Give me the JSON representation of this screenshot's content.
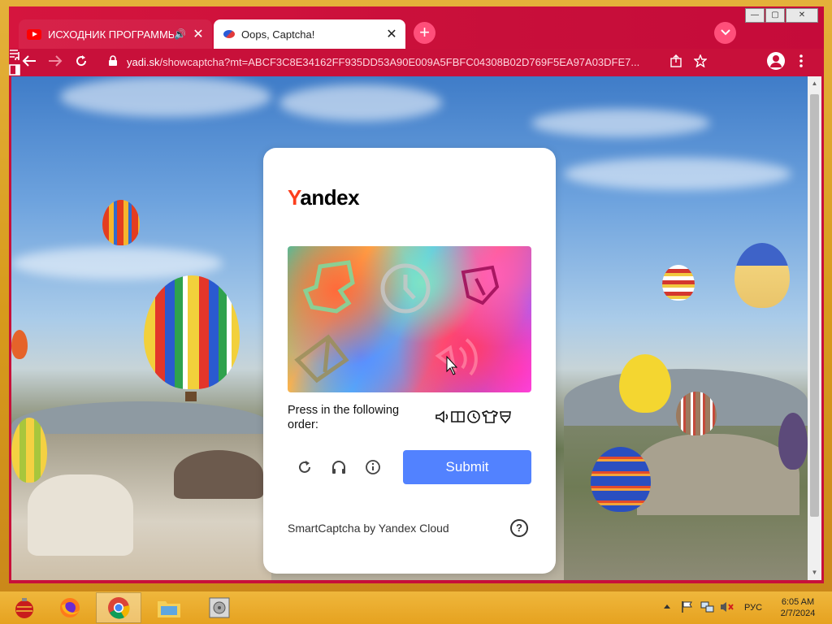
{
  "browser": {
    "tabs": [
      {
        "title": "ИСХОДНИК ПРОГРАММЫ Д",
        "audio": "🔊",
        "close": "✕",
        "active": false
      },
      {
        "title": "Oops, Captcha!",
        "close": "✕",
        "active": true
      }
    ],
    "new_tab": "+",
    "url_domain": "yadi.sk",
    "url_path": "/showcaptcha?mt=ABCF3C8E34162FF935DD53A90E009A5FBFC04308B02D769F5EA97A03DFE7...",
    "window_controls": {
      "minimize": "—",
      "maximize": "▢",
      "close": "✕"
    }
  },
  "captcha": {
    "brand_first": "Y",
    "brand_rest": "andex",
    "instruction": "Press in the following order:",
    "sequence_icons": [
      "speaker-icon",
      "book-icon",
      "clock-icon",
      "shirt-icon",
      "shield-icon"
    ],
    "sequence_glyphs": [
      "🕪",
      "📖",
      "🕓",
      "👕",
      "🛡"
    ],
    "submit_label": "Submit",
    "footer": "SmartCaptcha by Yandex Cloud",
    "help": "?"
  },
  "taskbar": {
    "language": "РУС",
    "time": "6:05 AM",
    "date": "2/7/2024"
  },
  "colors": {
    "browser_frame": "#c8103a",
    "submit": "#5282ff",
    "brand_accent": "#fc3f1d"
  }
}
